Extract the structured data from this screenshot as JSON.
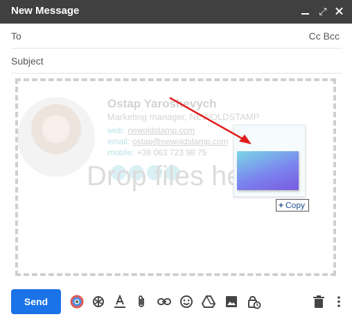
{
  "window": {
    "title": "New Message",
    "controls": {
      "minimize": "minimize-icon",
      "expand": "expand-icon",
      "close": "close-icon"
    }
  },
  "fields": {
    "to_label": "To",
    "cc_bcc": "Cc Bcc",
    "subject_label": "Subject"
  },
  "signature": {
    "name": "Ostap Yaroshevych",
    "role": "Marketing manager, NEWOLDSTAMP",
    "web_label": "web:",
    "web": "newoldstamp.com",
    "email_label": "email:",
    "email": "ostap@newoldstamp.com",
    "mobile_label": "mobile:",
    "mobile": "+38 063 723 98 75"
  },
  "dropzone": {
    "text": "Drop files here"
  },
  "drag": {
    "copy_label": "Copy",
    "copy_prefix": "+"
  },
  "toolbar": {
    "send_label": "Send",
    "icons": [
      "formatting-icon",
      "ai-icon",
      "text-format-icon",
      "attach-icon",
      "link-icon",
      "emoji-icon",
      "drive-icon",
      "photo-icon",
      "confidential-icon",
      "trash-icon",
      "more-icon"
    ]
  },
  "colors": {
    "titlebar": "#404040",
    "send": "#1a73e8",
    "arrow": "#e21b1b",
    "copy_text": "#1a4c92"
  }
}
